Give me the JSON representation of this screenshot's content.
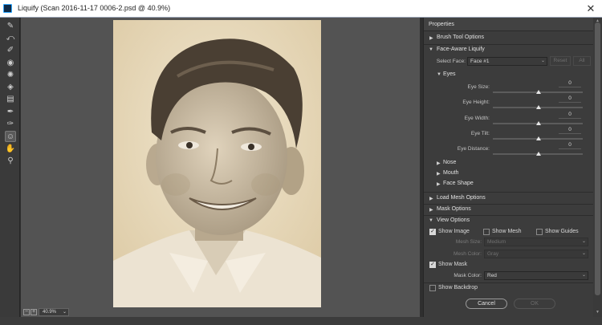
{
  "window": {
    "title": "Liquify (Scan 2016-11-17 0006-2.psd @ 40.9%)"
  },
  "toolbar": {
    "tools": [
      {
        "name": "forward-warp-tool",
        "glyph": "✎"
      },
      {
        "name": "reconstruct-tool",
        "glyph": "⤺"
      },
      {
        "name": "smooth-tool",
        "glyph": "✐"
      },
      {
        "name": "twirl-clockwise-tool",
        "glyph": "◉"
      },
      {
        "name": "pucker-tool",
        "glyph": "✺"
      },
      {
        "name": "bloat-tool",
        "glyph": "◈"
      },
      {
        "name": "push-left-tool",
        "glyph": "▤"
      },
      {
        "name": "freeze-mask-tool",
        "glyph": "✒"
      },
      {
        "name": "thaw-mask-tool",
        "glyph": "✑"
      },
      {
        "name": "face-tool",
        "glyph": "☺"
      },
      {
        "name": "hand-tool",
        "glyph": "✋"
      },
      {
        "name": "zoom-tool",
        "glyph": "⚲"
      }
    ]
  },
  "canvas": {
    "zoom": "40.9%"
  },
  "panel": {
    "header": "Properties",
    "brush_tool_options": "Brush Tool Options",
    "face_aware": {
      "title": "Face-Aware Liquify",
      "select_face_label": "Select Face:",
      "select_face_value": "Face #1",
      "reset_label": "Reset",
      "all_label": "All",
      "eyes_label": "Eyes",
      "sliders": [
        {
          "label": "Eye Size:",
          "value": "0"
        },
        {
          "label": "Eye Height:",
          "value": "0"
        },
        {
          "label": "Eye Width:",
          "value": "0"
        },
        {
          "label": "Eye Tilt:",
          "value": "0"
        },
        {
          "label": "Eye Distance:",
          "value": "0"
        }
      ],
      "nose_label": "Nose",
      "mouth_label": "Mouth",
      "face_shape_label": "Face Shape"
    },
    "load_mesh_options": "Load Mesh Options",
    "mask_options": "Mask Options",
    "view_options": {
      "title": "View Options",
      "show_image": "Show Image",
      "show_mesh": "Show Mesh",
      "show_guides": "Show Guides",
      "mesh_size_label": "Mesh Size:",
      "mesh_size_value": "Medium",
      "mesh_color_label": "Mesh Color:",
      "mesh_color_value": "Gray",
      "show_mask": "Show Mask",
      "mask_color_label": "Mask Color:",
      "mask_color_value": "Red",
      "show_backdrop": "Show Backdrop"
    },
    "cancel_label": "Cancel",
    "ok_label": "OK"
  },
  "colors": {
    "panel_bg": "#3c3c3c",
    "canvas_bg": "#535353",
    "photo_tone": "#e8dcc3"
  }
}
